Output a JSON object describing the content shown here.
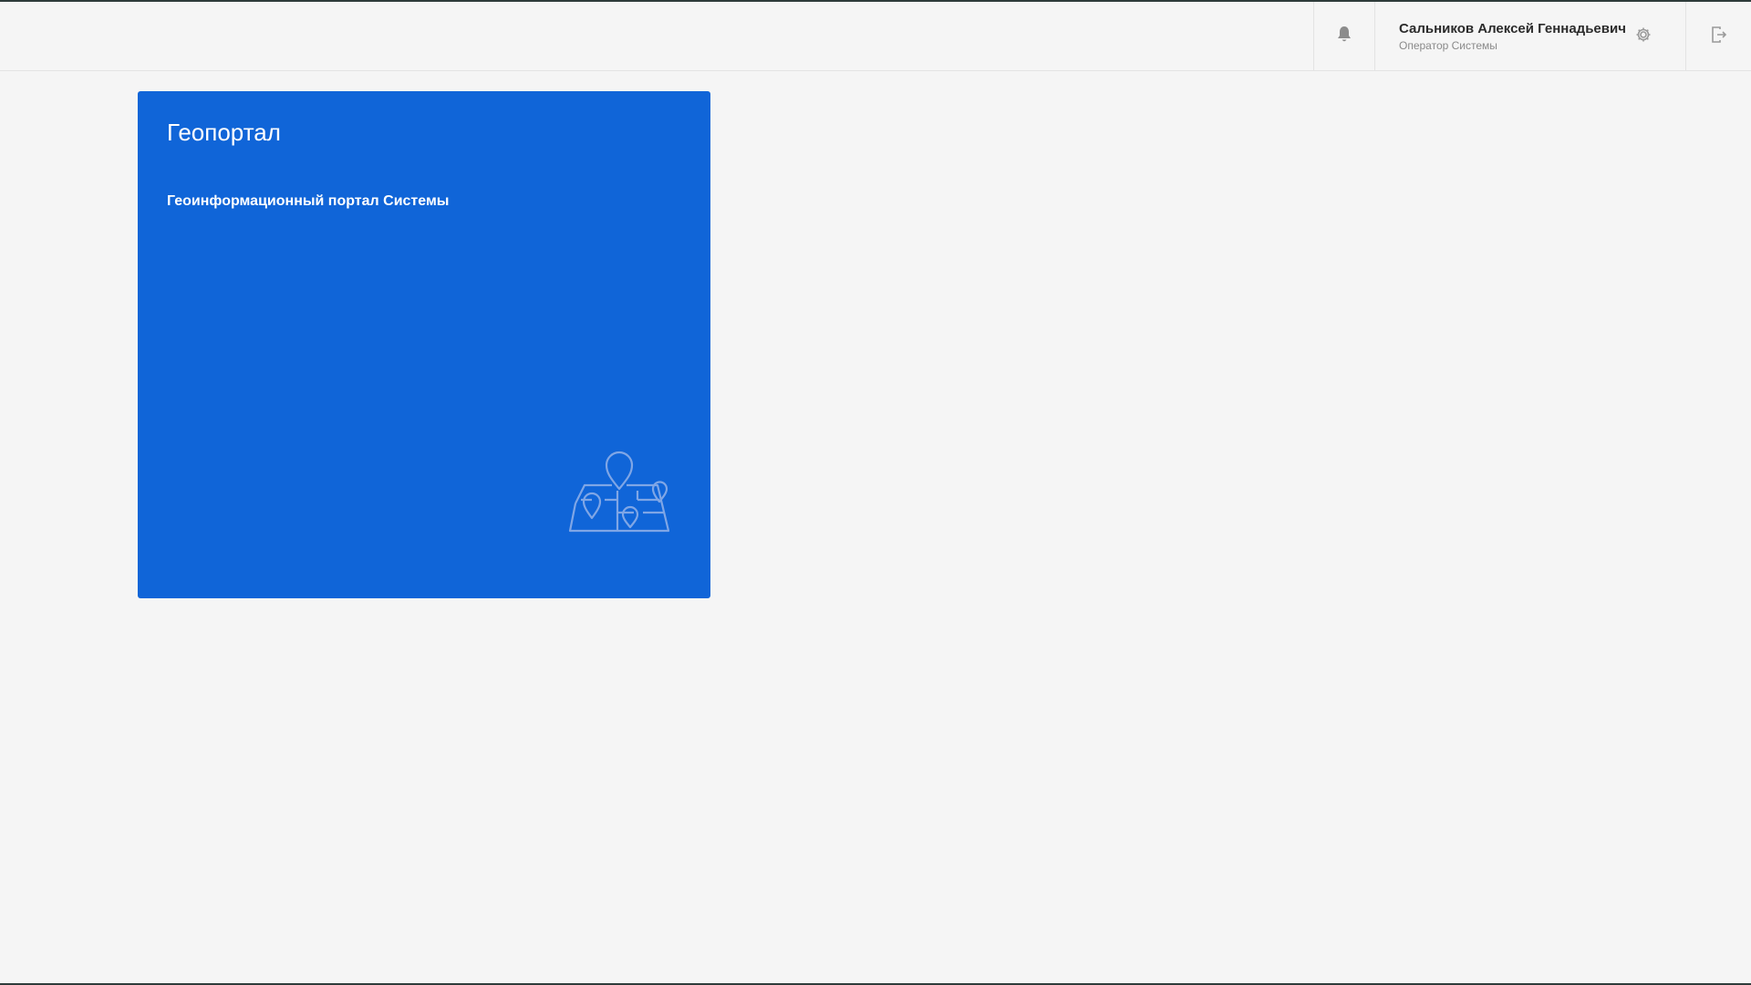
{
  "header": {
    "user": {
      "name": "Сальников Алексей Геннадьевич",
      "role": "Оператор Системы"
    },
    "icons": {
      "notifications": "bell-icon",
      "settings": "gear-icon",
      "logout": "logout-icon"
    }
  },
  "tiles": [
    {
      "title": "Геопортал",
      "description": "Геоинформационный портал Системы",
      "icon": "map-pins-icon",
      "color": "#1065d8"
    }
  ],
  "colors": {
    "background": "#f5f5f5",
    "tile_accent": "#1065d8",
    "icon_gray": "#9a9a9a"
  }
}
